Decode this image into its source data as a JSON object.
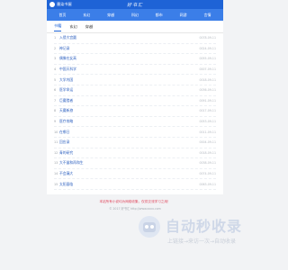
{
  "header": {
    "brand": "墨染书屋",
    "title": "好书汇"
  },
  "nav": [
    "首页",
    "玄幻",
    "穿越",
    "科幻",
    "都市",
    "网游",
    "言情"
  ],
  "tabs": [
    "书籍",
    "玄幻",
    "穿越"
  ],
  "list": [
    {
      "n": "1",
      "title": "入侵大宫圆",
      "date": "0078-09-11"
    },
    {
      "n": "2",
      "title": "神记录",
      "date": "0024-09-11"
    },
    {
      "n": "3",
      "title": "偶像在女高",
      "date": "0055-09-11"
    },
    {
      "n": "4",
      "title": "中国天科学",
      "date": "0007-09-11"
    },
    {
      "n": "5",
      "title": "大学内国",
      "date": "0018-09-11"
    },
    {
      "n": "6",
      "title": "医学命运",
      "date": "0036-09-11"
    },
    {
      "n": "7",
      "title": "巨魔猎者",
      "date": "0091-09-11"
    },
    {
      "n": "8",
      "title": "天魔新旅",
      "date": "0017-09-11"
    },
    {
      "n": "9",
      "title": "医疗攻略",
      "date": "0053-09-11"
    },
    {
      "n": "10",
      "title": "在哪日",
      "date": "0011-09-11"
    },
    {
      "n": "11",
      "title": "回应录",
      "date": "0004-09-11"
    },
    {
      "n": "12",
      "title": "青的研究",
      "date": "0018-09-11"
    },
    {
      "n": "13",
      "title": "大不量和再和生",
      "date": "0038-09-11"
    },
    {
      "n": "14",
      "title": "不会漏大",
      "date": "0074-09-11"
    },
    {
      "n": "15",
      "title": "太阳面临",
      "date": "0063-09-11"
    }
  ],
  "footer": {
    "note": "本站所有小说均为网络收集，仅供交流学习之用！",
    "copyright": "© 2017 好书汇 http://www.xxxx.com"
  },
  "watermark": {
    "main": "自动秒收录",
    "sub": "上链接→来访一次→自动收录"
  }
}
